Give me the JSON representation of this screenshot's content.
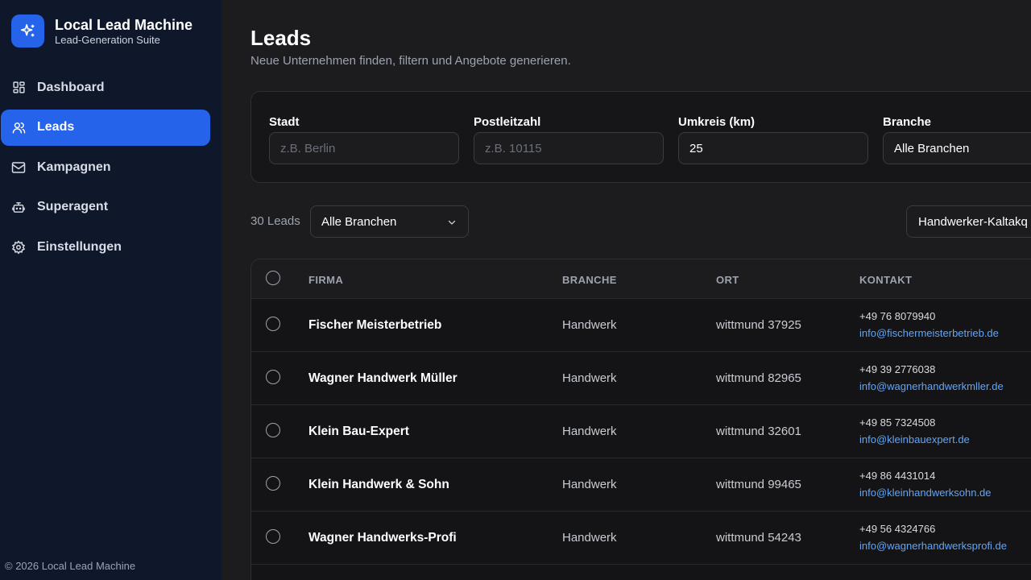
{
  "app": {
    "title": "Local Lead Machine",
    "subtitle": "Lead-Generation Suite",
    "footer": "© 2026 Local Lead Machine",
    "accent_color": "#2563eb",
    "logo_icon": "sparkles-icon"
  },
  "sidebar": {
    "items": [
      {
        "label": "Dashboard",
        "icon": "grid-icon"
      },
      {
        "label": "Leads",
        "icon": "users-icon",
        "active": true
      },
      {
        "label": "Kampagnen",
        "icon": "mail-icon"
      },
      {
        "label": "Superagent",
        "icon": "bot-icon"
      },
      {
        "label": "Einstellungen",
        "icon": "gear-icon"
      }
    ]
  },
  "page": {
    "title": "Leads",
    "subtitle": "Neue Unternehmen finden, filtern und Angebote generieren."
  },
  "filters": {
    "city": {
      "label": "Stadt",
      "placeholder": "z.B. Berlin",
      "value": ""
    },
    "zip": {
      "label": "Postleitzahl",
      "placeholder": "z.B. 10115",
      "value": ""
    },
    "radius": {
      "label": "Umkreis (km)",
      "value": "25"
    },
    "industry": {
      "label": "Branche",
      "value": "Alle Branchen"
    }
  },
  "toolbar": {
    "count": "30 Leads",
    "industry_select": "Alle Branchen",
    "template_select": "Handwerker-Kaltakq"
  },
  "table": {
    "columns": [
      "FIRMA",
      "BRANCHE",
      "ORT",
      "KONTAKT"
    ],
    "rows": [
      {
        "firma": "Fischer Meisterbetrieb",
        "branche": "Handwerk",
        "ort": "wittmund 37925",
        "phone": "+49 76 8079940",
        "email": "info@fischermeisterbetrieb.de"
      },
      {
        "firma": "Wagner Handwerk Müller",
        "branche": "Handwerk",
        "ort": "wittmund 82965",
        "phone": "+49 39 2776038",
        "email": "info@wagnerhandwerkmller.de"
      },
      {
        "firma": "Klein Bau-Expert",
        "branche": "Handwerk",
        "ort": "wittmund 32601",
        "phone": "+49 85 7324508",
        "email": "info@kleinbauexpert.de"
      },
      {
        "firma": "Klein Handwerk & Sohn",
        "branche": "Handwerk",
        "ort": "wittmund 99465",
        "phone": "+49 86 4431014",
        "email": "info@kleinhandwerksohn.de"
      },
      {
        "firma": "Wagner Handwerks-Profi",
        "branche": "Handwerk",
        "ort": "wittmund 54243",
        "phone": "+49 56 4324766",
        "email": "info@wagnerhandwerksprofi.de"
      }
    ]
  }
}
